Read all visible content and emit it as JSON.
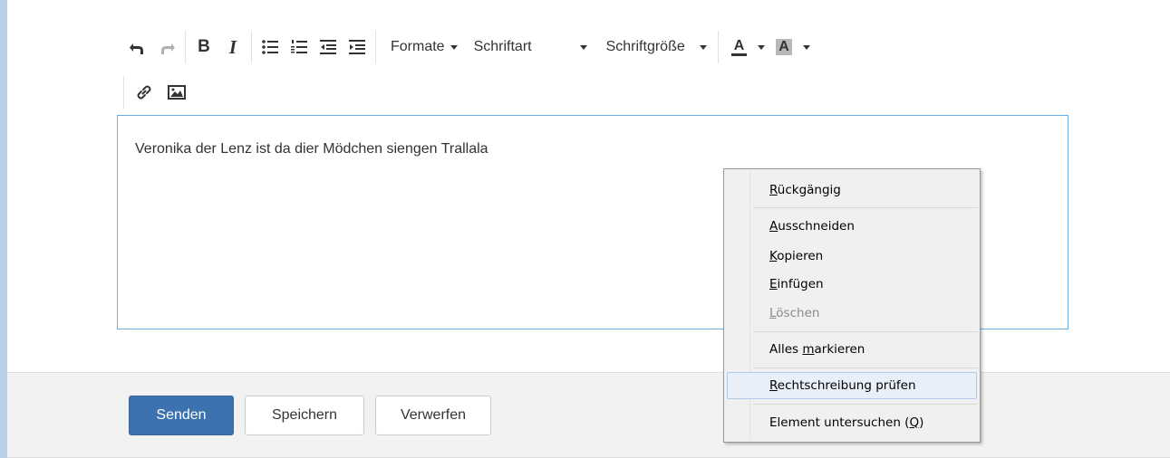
{
  "toolbar": {
    "bold_label": "B",
    "italic_label": "I",
    "formats_label": "Formate",
    "font_label": "Schriftart",
    "fontsize_label": "Schriftgröße",
    "forecolor_label": "A",
    "backcolor_label": "A"
  },
  "editor": {
    "text": "Veronika der Lenz ist da dier Mödchen siengen Trallala"
  },
  "buttons": {
    "send": "Senden",
    "save": "Speichern",
    "discard": "Verwerfen"
  },
  "context_menu": {
    "items": [
      {
        "accel": "R",
        "rest": "ückgängig"
      },
      {
        "accel": "A",
        "rest": "usschneiden"
      },
      {
        "accel": "K",
        "rest": "opieren"
      },
      {
        "accel": "E",
        "rest": "infügen"
      },
      {
        "accel": "L",
        "rest": "öschen"
      },
      {
        "pre": "Alles ",
        "accel": "m",
        "rest": "arkieren"
      },
      {
        "accel": "R",
        "rest": "echtschreibung prüfen"
      },
      {
        "pre": "Element untersuchen (",
        "accel": "Q",
        "rest": ")"
      }
    ]
  },
  "colors": {
    "primary": "#3d72b0",
    "editor_border": "#66afe9",
    "left_bar": "#b9cfe8",
    "footer_bg": "#f2f2f2",
    "menu_hover": "#e8eff8"
  }
}
